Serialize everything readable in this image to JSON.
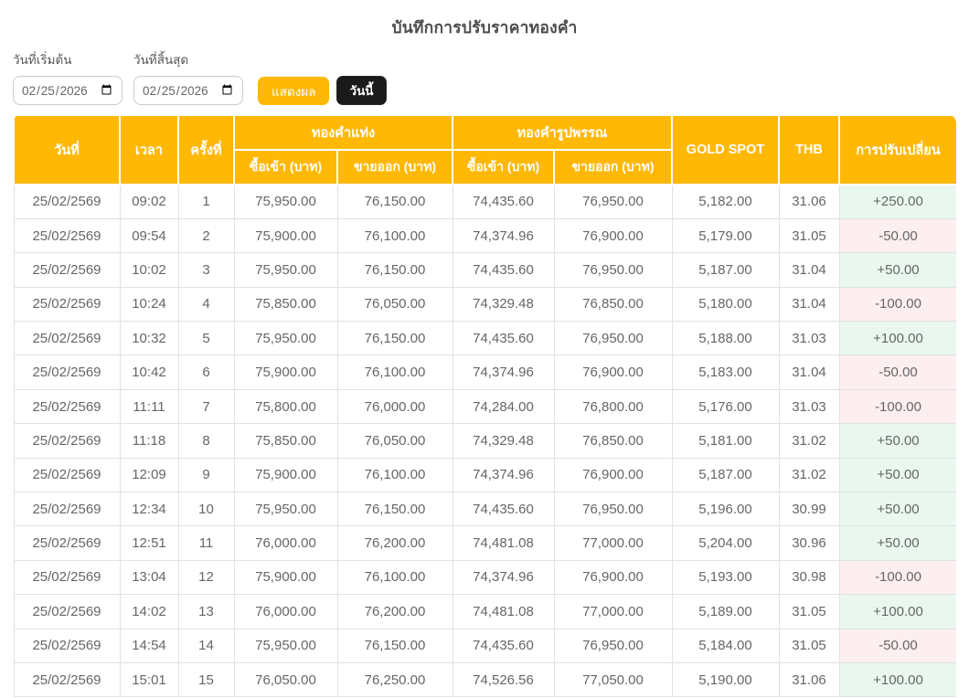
{
  "page": {
    "title": "บันทึกการปรับราคาทองคำ"
  },
  "filters": {
    "start_date_label": "วันที่เริ่มต้น",
    "end_date_label": "วันที่สิ้นสุด",
    "start_date_value": "2026-02-25",
    "end_date_value": "2026-02-25",
    "start_date_display": "02 / 25 / 2026",
    "end_date_display": "02 / 25 / 2026",
    "show_results_button": "แสดงผล",
    "today_button": "วันนี้"
  },
  "colors": {
    "gold": "#FFB806",
    "button_dark": "#1A1A1A",
    "positive_bg": "#E9F7EF",
    "negative_bg": "#FDEEF0",
    "body_text": "#666666",
    "border": "#DEE2E6"
  },
  "table": {
    "headers": {
      "date": "วันที่",
      "time": "เวลา",
      "round": "ครั้งที่",
      "gold_bar_group": "ทองคำแท่ง",
      "gold_ornament_group": "ทองคำรูปพรรณ",
      "bar_buy": "ซื้อเข้า (บาท)",
      "bar_sell": "ขายออก (บาท)",
      "orn_buy": "ซื้อเข้า (บาท)",
      "orn_sell": "ขายออก (บาท)",
      "gold_spot": "GOLD SPOT",
      "thb": "THB",
      "change": "การปรับเปลี่ยน"
    },
    "rows": [
      {
        "date": "25/02/2569",
        "time": "09:02",
        "no": "1",
        "bar_buy": "75,950.00",
        "bar_sell": "76,150.00",
        "orn_buy": "74,435.60",
        "orn_sell": "76,950.00",
        "spot": "5,182.00",
        "thb": "31.06",
        "change": "+250.00",
        "trend": "up"
      },
      {
        "date": "25/02/2569",
        "time": "09:54",
        "no": "2",
        "bar_buy": "75,900.00",
        "bar_sell": "76,100.00",
        "orn_buy": "74,374.96",
        "orn_sell": "76,900.00",
        "spot": "5,179.00",
        "thb": "31.05",
        "change": "-50.00",
        "trend": "down"
      },
      {
        "date": "25/02/2569",
        "time": "10:02",
        "no": "3",
        "bar_buy": "75,950.00",
        "bar_sell": "76,150.00",
        "orn_buy": "74,435.60",
        "orn_sell": "76,950.00",
        "spot": "5,187.00",
        "thb": "31.04",
        "change": "+50.00",
        "trend": "up"
      },
      {
        "date": "25/02/2569",
        "time": "10:24",
        "no": "4",
        "bar_buy": "75,850.00",
        "bar_sell": "76,050.00",
        "orn_buy": "74,329.48",
        "orn_sell": "76,850.00",
        "spot": "5,180.00",
        "thb": "31.04",
        "change": "-100.00",
        "trend": "down"
      },
      {
        "date": "25/02/2569",
        "time": "10:32",
        "no": "5",
        "bar_buy": "75,950.00",
        "bar_sell": "76,150.00",
        "orn_buy": "74,435.60",
        "orn_sell": "76,950.00",
        "spot": "5,188.00",
        "thb": "31.03",
        "change": "+100.00",
        "trend": "up"
      },
      {
        "date": "25/02/2569",
        "time": "10:42",
        "no": "6",
        "bar_buy": "75,900.00",
        "bar_sell": "76,100.00",
        "orn_buy": "74,374.96",
        "orn_sell": "76,900.00",
        "spot": "5,183.00",
        "thb": "31.04",
        "change": "-50.00",
        "trend": "down"
      },
      {
        "date": "25/02/2569",
        "time": "11:11",
        "no": "7",
        "bar_buy": "75,800.00",
        "bar_sell": "76,000.00",
        "orn_buy": "74,284.00",
        "orn_sell": "76,800.00",
        "spot": "5,176.00",
        "thb": "31.03",
        "change": "-100.00",
        "trend": "down"
      },
      {
        "date": "25/02/2569",
        "time": "11:18",
        "no": "8",
        "bar_buy": "75,850.00",
        "bar_sell": "76,050.00",
        "orn_buy": "74,329.48",
        "orn_sell": "76,850.00",
        "spot": "5,181.00",
        "thb": "31.02",
        "change": "+50.00",
        "trend": "up"
      },
      {
        "date": "25/02/2569",
        "time": "12:09",
        "no": "9",
        "bar_buy": "75,900.00",
        "bar_sell": "76,100.00",
        "orn_buy": "74,374.96",
        "orn_sell": "76,900.00",
        "spot": "5,187.00",
        "thb": "31.02",
        "change": "+50.00",
        "trend": "up"
      },
      {
        "date": "25/02/2569",
        "time": "12:34",
        "no": "10",
        "bar_buy": "75,950.00",
        "bar_sell": "76,150.00",
        "orn_buy": "74,435.60",
        "orn_sell": "76,950.00",
        "spot": "5,196.00",
        "thb": "30.99",
        "change": "+50.00",
        "trend": "up"
      },
      {
        "date": "25/02/2569",
        "time": "12:51",
        "no": "11",
        "bar_buy": "76,000.00",
        "bar_sell": "76,200.00",
        "orn_buy": "74,481.08",
        "orn_sell": "77,000.00",
        "spot": "5,204.00",
        "thb": "30.96",
        "change": "+50.00",
        "trend": "up"
      },
      {
        "date": "25/02/2569",
        "time": "13:04",
        "no": "12",
        "bar_buy": "75,900.00",
        "bar_sell": "76,100.00",
        "orn_buy": "74,374.96",
        "orn_sell": "76,900.00",
        "spot": "5,193.00",
        "thb": "30.98",
        "change": "-100.00",
        "trend": "down"
      },
      {
        "date": "25/02/2569",
        "time": "14:02",
        "no": "13",
        "bar_buy": "76,000.00",
        "bar_sell": "76,200.00",
        "orn_buy": "74,481.08",
        "orn_sell": "77,000.00",
        "spot": "5,189.00",
        "thb": "31.05",
        "change": "+100.00",
        "trend": "up"
      },
      {
        "date": "25/02/2569",
        "time": "14:54",
        "no": "14",
        "bar_buy": "75,950.00",
        "bar_sell": "76,150.00",
        "orn_buy": "74,435.60",
        "orn_sell": "76,950.00",
        "spot": "5,184.00",
        "thb": "31.05",
        "change": "-50.00",
        "trend": "down"
      },
      {
        "date": "25/02/2569",
        "time": "15:01",
        "no": "15",
        "bar_buy": "76,050.00",
        "bar_sell": "76,250.00",
        "orn_buy": "74,526.56",
        "orn_sell": "77,050.00",
        "spot": "5,190.00",
        "thb": "31.06",
        "change": "+100.00",
        "trend": "up"
      }
    ]
  }
}
